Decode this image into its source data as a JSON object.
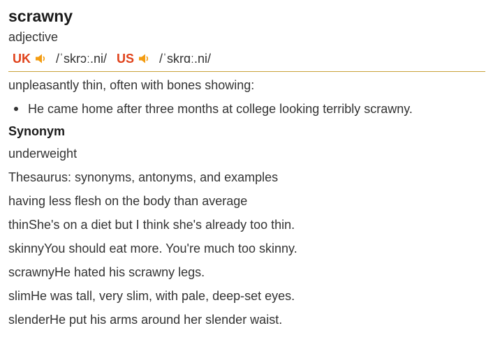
{
  "entry": {
    "headword": "scrawny",
    "part_of_speech": "adjective",
    "pronunciations": [
      {
        "region": "UK",
        "ipa": "/ˈskrɔː.ni/",
        "icon": "speaker-icon"
      },
      {
        "region": "US",
        "ipa": "/ˈskrɑː.ni/",
        "icon": "speaker-icon"
      }
    ],
    "definition": "unpleasantly thin, often with bones showing:",
    "example": "He came home after three months at college looking terribly scrawny.",
    "synonym_heading": "Synonym",
    "synonym": "underweight",
    "thesaurus_heading": "Thesaurus: synonyms, antonyms, and examples",
    "thesaurus_definition": "having less flesh on the body than average",
    "thesaurus_items": [
      "thinShe's on a diet but I think she's already too thin.",
      "skinnyYou should eat more. You're much too skinny.",
      "scrawnyHe hated his scrawny legs.",
      "slimHe was tall, very slim, with pale, deep-set eyes.",
      "slenderHe put his arms around her slender waist."
    ]
  },
  "colors": {
    "region_accent": "#e0421b",
    "speaker_accent": "#f39c12",
    "divider": "#c9a23a"
  }
}
